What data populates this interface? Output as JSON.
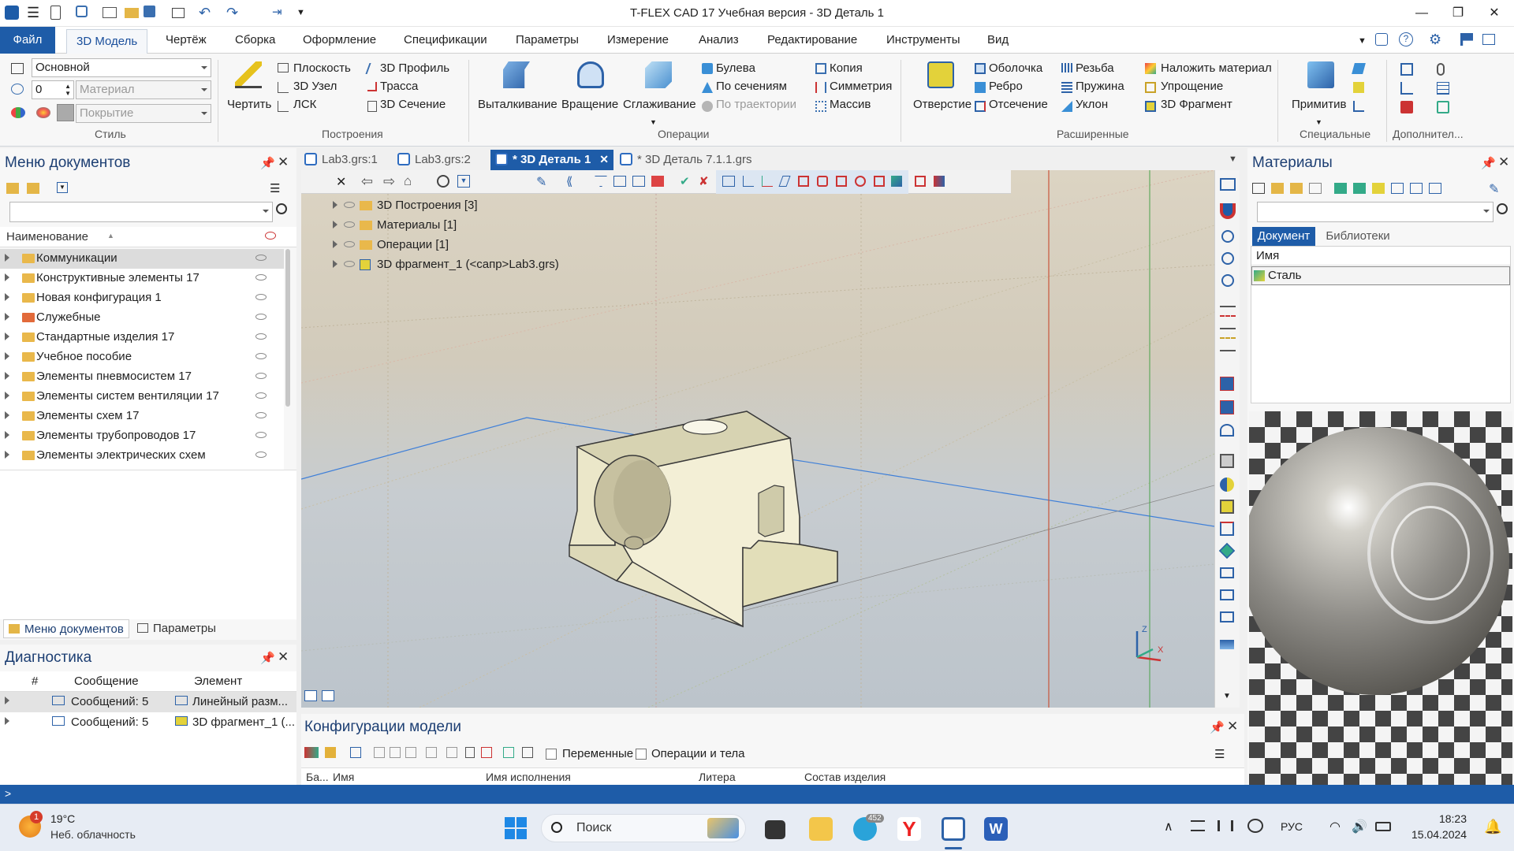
{
  "titlebar": {
    "title": "T-FLEX CAD 17 Учебная версия - 3D Деталь 1",
    "min": "—",
    "restore": "❐",
    "close": "✕"
  },
  "menu": {
    "file": "Файл",
    "tabs": [
      "3D Модель",
      "Чертёж",
      "Сборка",
      "Оформление",
      "Спецификации",
      "Параметры",
      "Измерение",
      "Анализ",
      "Редактирование",
      "Инструменты",
      "Вид"
    ]
  },
  "ribbon": {
    "style": {
      "combo1": "Основной",
      "combo2_num": "0",
      "combo2_mat": "Материал",
      "combo3": "Покрытие",
      "label": "Стиль"
    },
    "construction": {
      "draw": "Чертить",
      "plane": "Плоскость",
      "node": "3D Узел",
      "lcs": "ЛСК",
      "profile": "3D Профиль",
      "path": "Трасса",
      "section": "3D Сечение",
      "label": "Построения"
    },
    "operations": {
      "extrude": "Выталкивание",
      "rotate": "Вращение",
      "smooth": "Сглаживание",
      "boolean": "Булева",
      "bysections": "По сечениям",
      "bypath": "По траектории",
      "copy": "Копия",
      "symmetry": "Симметрия",
      "array": "Массив",
      "label": "Операции"
    },
    "extended": {
      "hole": "Отверстие",
      "shell": "Оболочка",
      "rib": "Ребро",
      "cut": "Отсечение",
      "thread": "Резьба",
      "spring": "Пружина",
      "slope": "Уклон",
      "apply_material": "Наложить материал",
      "simplify": "Упрощение",
      "fragment": "3D Фрагмент",
      "label": "Расширенные"
    },
    "special": {
      "primitive": "Примитив",
      "label": "Специальные"
    },
    "extra": {
      "label": "Дополнител..."
    }
  },
  "docmenu": {
    "title": "Меню документов",
    "header": "Наименование",
    "items": [
      "Коммуникации",
      "Конструктивные элементы 17",
      "Новая конфигурация 1",
      "Служебные",
      "Стандартные изделия 17",
      "Учебное пособие",
      "Элементы пневмосистем 17",
      "Элементы систем вентиляции 17",
      "Элементы схем 17",
      "Элементы трубопроводов 17",
      "Элементы электрических схем"
    ],
    "tab1": "Меню документов",
    "tab2": "Параметры"
  },
  "diagnostics": {
    "title": "Диагностика",
    "cols": [
      "#",
      "Сообщение",
      "Элемент"
    ],
    "rows": [
      {
        "msg": "Сообщений: 5",
        "el": "Линейный разм..."
      },
      {
        "msg": "Сообщений: 5",
        "el": "3D фрагмент_1 (..."
      }
    ]
  },
  "doctabs": [
    {
      "label": "Lab3.grs:1"
    },
    {
      "label": "Lab3.grs:2"
    },
    {
      "label": "* 3D Деталь 1"
    },
    {
      "label": "* 3D Деталь 7.1.1.grs"
    }
  ],
  "modeltree": [
    {
      "label": "3D Построения [3]"
    },
    {
      "label": "Материалы [1]"
    },
    {
      "label": "Операции [1]"
    },
    {
      "label": "3D фрагмент_1 (<сапр>Lab3.grs)"
    }
  ],
  "axes": {
    "z": "Z",
    "x": "X"
  },
  "materials": {
    "title": "Материалы",
    "tab_doc": "Документ",
    "tab_lib": "Библиотеки",
    "col": "Имя",
    "items": [
      "Сталь"
    ]
  },
  "configs": {
    "title": "Конфигурации модели",
    "chk1": "Переменные",
    "chk2": "Операции и тела",
    "cols": [
      "Ба...",
      "Имя",
      "Имя исполнения",
      "Литера",
      "Состав изделия"
    ]
  },
  "status": {
    "text": ">"
  },
  "taskbar": {
    "weather_temp": "19°C",
    "weather_desc": "Неб. облачность",
    "weather_badge": "1",
    "search": "Поиск",
    "lang": "РУС",
    "time": "18:23",
    "date": "15.04.2024",
    "telegram_badge": "452"
  },
  "colors": {
    "accent": "#1e5ca8",
    "part": "#e8e6c8"
  }
}
